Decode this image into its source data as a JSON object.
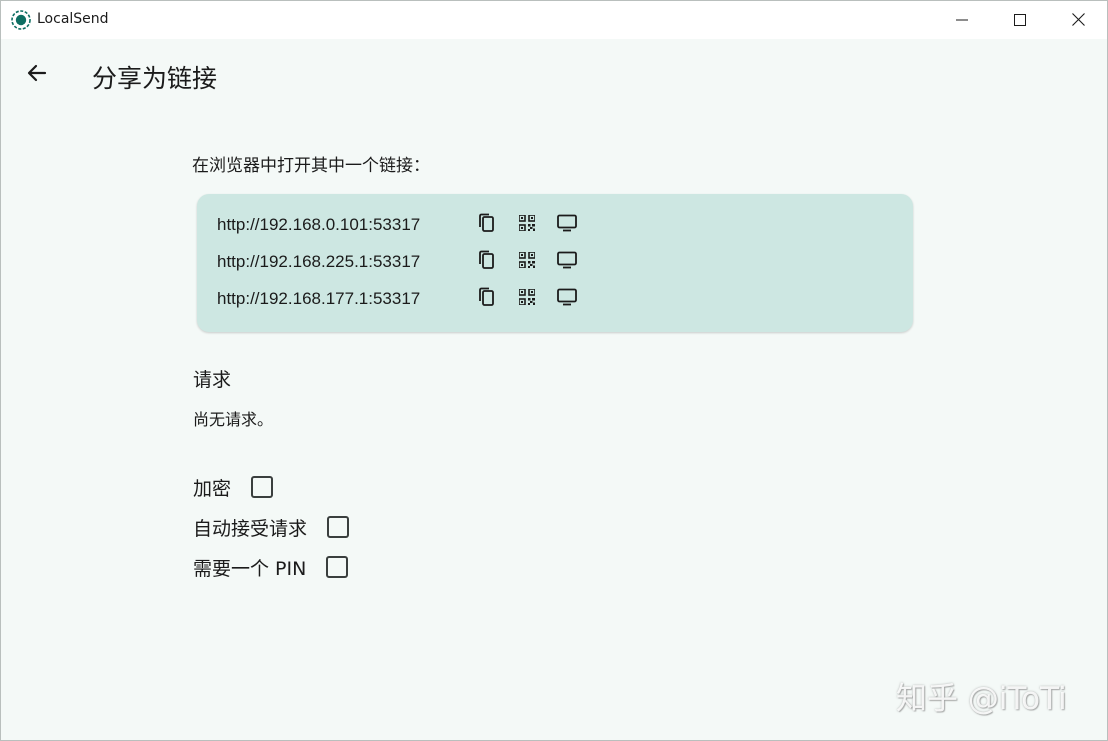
{
  "window": {
    "app_title": "LocalSend",
    "accent_color": "#0d6e62"
  },
  "appbar": {
    "back_icon": "arrow-left-icon",
    "title": "分享为链接"
  },
  "links": {
    "heading": "在浏览器中打开其中一个链接：",
    "card_color": "#cde7e2",
    "items": [
      {
        "url": "http://192.168.0.101:53317"
      },
      {
        "url": "http://192.168.225.1:53317"
      },
      {
        "url": "http://192.168.177.1:53317"
      }
    ],
    "row_icons": [
      "copy-icon",
      "qr-code-icon",
      "monitor-icon"
    ]
  },
  "requests": {
    "title": "请求",
    "empty_text": "尚无请求。"
  },
  "options": {
    "encrypt": {
      "label": "加密",
      "checked": false
    },
    "auto_accept": {
      "label": "自动接受请求",
      "checked": false
    },
    "require_pin": {
      "label": "需要一个 PIN",
      "checked": false
    }
  },
  "watermark": {
    "text": "知乎 @iToTi"
  }
}
